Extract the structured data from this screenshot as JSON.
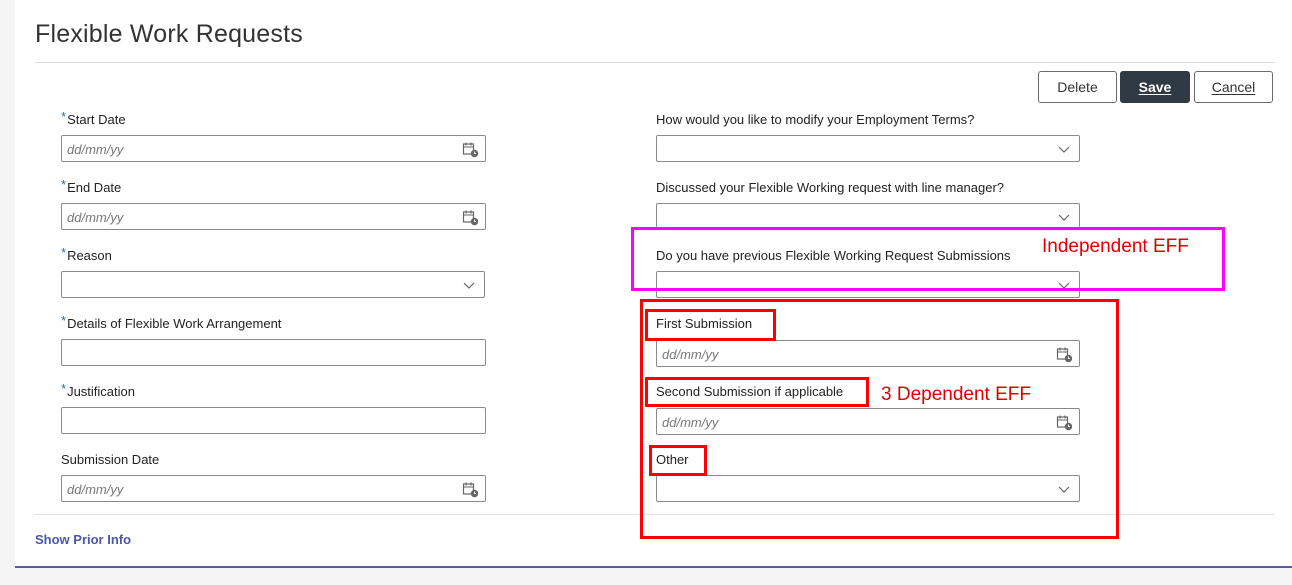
{
  "page": {
    "title": "Flexible Work Requests"
  },
  "toolbar": {
    "delete_label": "Delete",
    "save_label": "Save",
    "cancel_label": "Cancel"
  },
  "left_fields": {
    "start_date": {
      "label": "Start Date",
      "required": true,
      "placeholder": "dd/mm/yy",
      "icon": "calendar-icon"
    },
    "end_date": {
      "label": "End Date",
      "required": true,
      "placeholder": "dd/mm/yy",
      "icon": "calendar-icon"
    },
    "reason": {
      "label": "Reason",
      "required": true,
      "value": "",
      "icon": "chevron-down-icon"
    },
    "details": {
      "label": "Details of Flexible Work Arrangement",
      "required": true,
      "value": ""
    },
    "justification": {
      "label": "Justification",
      "required": true,
      "value": ""
    },
    "submission_date": {
      "label": "Submission Date",
      "required": false,
      "placeholder": "dd/mm/yy",
      "icon": "calendar-icon"
    }
  },
  "right_fields": {
    "modify_terms": {
      "label": "How would you like to modify your Employment Terms?",
      "value": "",
      "icon": "chevron-down-icon"
    },
    "discussed": {
      "label": "Discussed your Flexible Working request with line manager?",
      "value": "",
      "icon": "chevron-down-icon"
    },
    "previous": {
      "label": "Do you have previous Flexible Working Request Submissions",
      "value": "",
      "icon": "chevron-down-icon"
    },
    "first_submission": {
      "label": "First Submission",
      "placeholder": "dd/mm/yy",
      "icon": "calendar-icon"
    },
    "second_submission": {
      "label": "Second Submission if applicable",
      "placeholder": "dd/mm/yy",
      "icon": "calendar-icon"
    },
    "other": {
      "label": "Other",
      "value": "",
      "icon": "chevron-down-icon"
    }
  },
  "footer": {
    "show_prior_label": "Show Prior Info"
  },
  "annotations": {
    "independent": "Independent EFF",
    "dependent": "3 Dependent EFF"
  },
  "colors": {
    "accent": "#2a6ebb",
    "save_button": "#2f3a45",
    "link": "#4b58a8",
    "annotation_pink": "#ff00ff",
    "annotation_red": "#ff0000"
  }
}
